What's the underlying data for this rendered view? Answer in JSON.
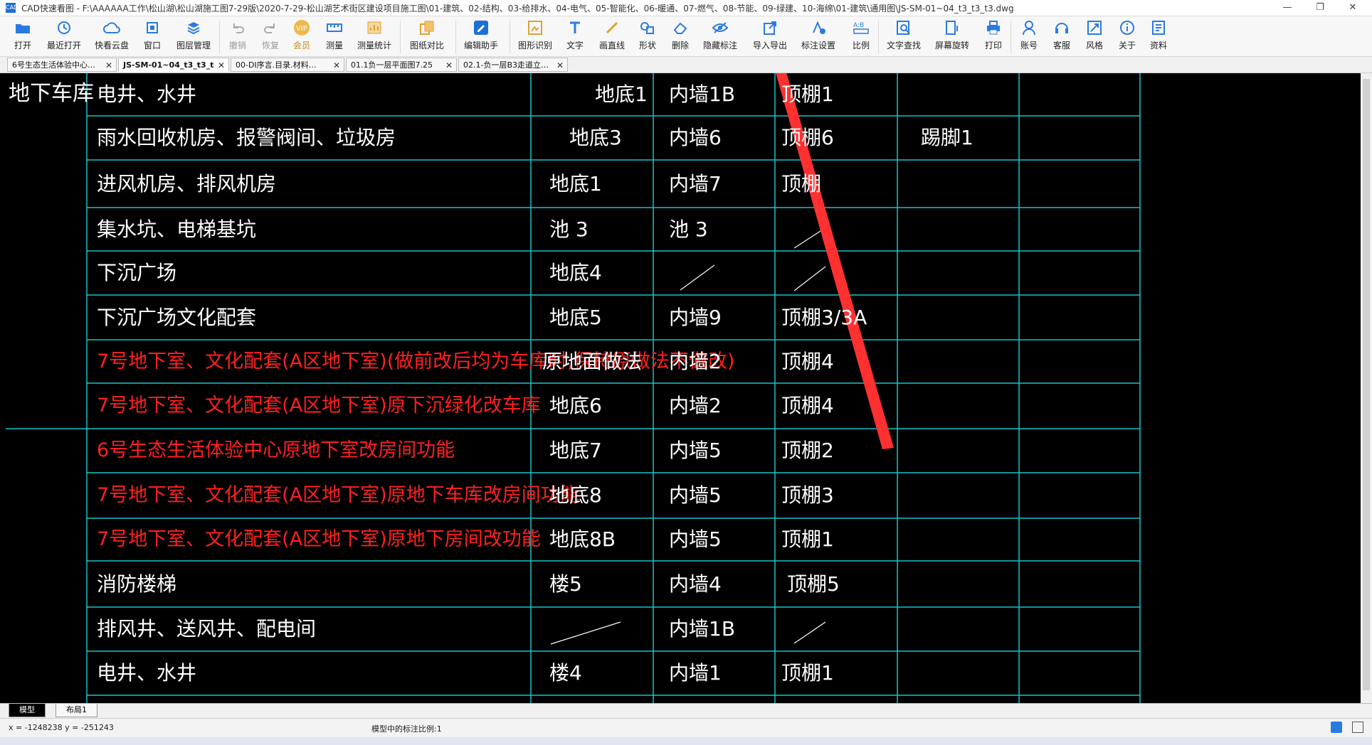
{
  "window": {
    "app_label": "CAD",
    "title": "CAD快速看图 - F:\\AAAAAA工作\\松山湖\\松山湖施工图7-29版\\2020-7-29-松山湖艺术街区建设项目施工图\\01-建筑、02-结构、03-给排水、04-电气、05-智能化、06-暖通、07-燃气、08-节能、09-绿建、10-海绵\\01-建筑\\通用图\\JS-SM-01~04_t3_t3_t3.dwg",
    "controls": [
      "—",
      "❐",
      "✕"
    ]
  },
  "toolbar": [
    {
      "label": "打开"
    },
    {
      "label": "最近打开"
    },
    {
      "label": "快看云盘"
    },
    {
      "label": "窗口"
    },
    {
      "label": "图层管理"
    },
    {
      "label": "撤销"
    },
    {
      "label": "恢复"
    },
    {
      "label": "会员"
    },
    {
      "label": "测量"
    },
    {
      "label": "测量统计"
    },
    {
      "label": "图纸对比"
    },
    {
      "label": "编辑助手"
    },
    {
      "label": "图形识别"
    },
    {
      "label": "文字"
    },
    {
      "label": "画直线"
    },
    {
      "label": "形状"
    },
    {
      "label": "删除"
    },
    {
      "label": "隐藏标注"
    },
    {
      "label": "导入导出"
    },
    {
      "label": "标注设置"
    },
    {
      "label": "比例"
    },
    {
      "label": "文字查找"
    },
    {
      "label": "屏幕旋转"
    },
    {
      "label": "打印"
    },
    {
      "label": "账号"
    },
    {
      "label": "客服"
    },
    {
      "label": "风格"
    },
    {
      "label": "关于"
    },
    {
      "label": "资料"
    }
  ],
  "tabs": [
    {
      "label": "6号生态生活体验中心…"
    },
    {
      "label": "JS-SM-01~04_t3_t3_t"
    },
    {
      "label": "00-DI序言.目录.材料…"
    },
    {
      "label": "01.1负一层平面图7.25"
    },
    {
      "label": "02.1-负一层B3走道立…"
    }
  ],
  "drawing": {
    "left_label": "地下车库",
    "rows": [
      {
        "name": "电井、水井",
        "red": false,
        "c1": "地底1",
        "c2": "内墙1B",
        "c3": "顶棚1",
        "c4": ""
      },
      {
        "name": "雨水回收机房、报警阀间、垃圾房",
        "red": false,
        "c1": "地底3",
        "c2": "内墙6",
        "c3": "顶棚6",
        "c4": "踢脚1"
      },
      {
        "name": "进风机房、排风机房",
        "red": false,
        "c1": "地底1",
        "c2": "内墙7",
        "c3": "顶棚",
        "c4": ""
      },
      {
        "name": "集水坑、电梯基坑",
        "red": false,
        "c1": "池 3",
        "c2": "池 3",
        "c3": "",
        "c4": ""
      },
      {
        "name": "下沉广场",
        "red": false,
        "c1": "地底4",
        "c2": "",
        "c3": "",
        "c4": ""
      },
      {
        "name": "下沉广场文化配套",
        "red": false,
        "c1": "地底5",
        "c2": "内墙9",
        "c3": "顶棚3/3A",
        "c4": ""
      },
      {
        "name": "7号地下室、文化配套(A区地下室)(做前改后均为车库时,保持原做法不做改)",
        "red": true,
        "c1": "原地面做法",
        "c2": "内墙2",
        "c3": "顶棚4",
        "c4": ""
      },
      {
        "name": "7号地下室、文化配套(A区地下室)原下沉绿化改车库",
        "red": true,
        "c1": "地底6",
        "c2": "内墙2",
        "c3": "顶棚4",
        "c4": ""
      },
      {
        "name": "6号生态生活体验中心原地下室改房间功能",
        "red": true,
        "c1": "地底7",
        "c2": "内墙5",
        "c3": "顶棚2",
        "c4": ""
      },
      {
        "name": "7号地下室、文化配套(A区地下室)原地下车库改房间功能",
        "red": true,
        "c1": "地底8",
        "c2": "内墙5",
        "c3": "顶棚3",
        "c4": ""
      },
      {
        "name": "7号地下室、文化配套(A区地下室)原地下房间改功能",
        "red": true,
        "c1": "地底8B",
        "c2": "内墙5",
        "c3": "顶棚1",
        "c4": ""
      },
      {
        "name": "消防楼梯",
        "red": false,
        "c1": "楼5",
        "c2": "内墙4",
        "c3": "顶棚5",
        "c4": ""
      },
      {
        "name": "排风井、送风井、配电间",
        "red": false,
        "c1": "",
        "c2": "内墙1B",
        "c3": "",
        "c4": ""
      },
      {
        "name": "电井、水井",
        "red": false,
        "c1": "楼4",
        "c2": "内墙1",
        "c3": "顶棚1",
        "c4": ""
      }
    ],
    "annotation_color": "#ff3030",
    "line_color": "#19c3c9"
  },
  "layout_tabs": [
    {
      "label": "模型"
    },
    {
      "label": "布局1"
    }
  ],
  "status": {
    "coords": "x = -1248238  y = -251243",
    "scale": "模型中的标注比例:1"
  }
}
